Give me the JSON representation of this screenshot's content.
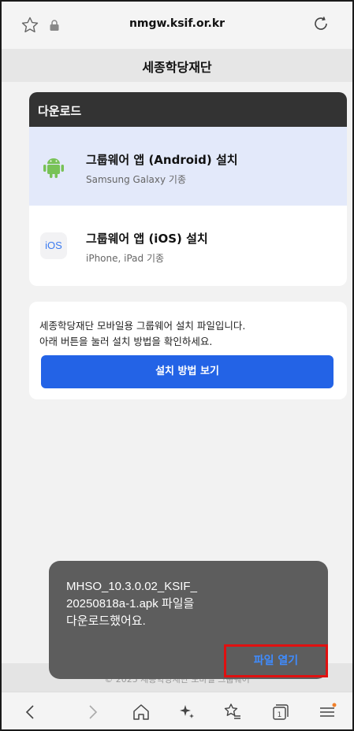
{
  "browser": {
    "url": "nmgw.ksif.or.kr"
  },
  "header": {
    "title": "세종학당재단"
  },
  "download": {
    "heading": "다운로드",
    "items": [
      {
        "name": "그룹웨어 앱 (Android) 설치",
        "sub": "Samsung Galaxy 기종"
      },
      {
        "name": "그룹웨어 앱 (iOS) 설치",
        "sub": "iPhone, iPad 기종",
        "badge": "iOS"
      }
    ]
  },
  "info": {
    "line1": "세종학당재단 모바일용 그룹웨어 설치 파일입니다.",
    "line2": "아래 버튼을 눌러 설치 방법을 확인하세요.",
    "button": "설치 방법 보기"
  },
  "footer": {
    "text": "© 2025 세종학당재단 모바일 그룹웨어"
  },
  "toast": {
    "line1": "MHSO_10.3.0.02_KSIF_",
    "line2": "20250818a-1.apk 파일을",
    "line3": "다운로드했어요.",
    "action": "파일 열기"
  },
  "colors": {
    "accent": "#2363e6",
    "android": "#78c257",
    "highlight": "#e01010"
  }
}
